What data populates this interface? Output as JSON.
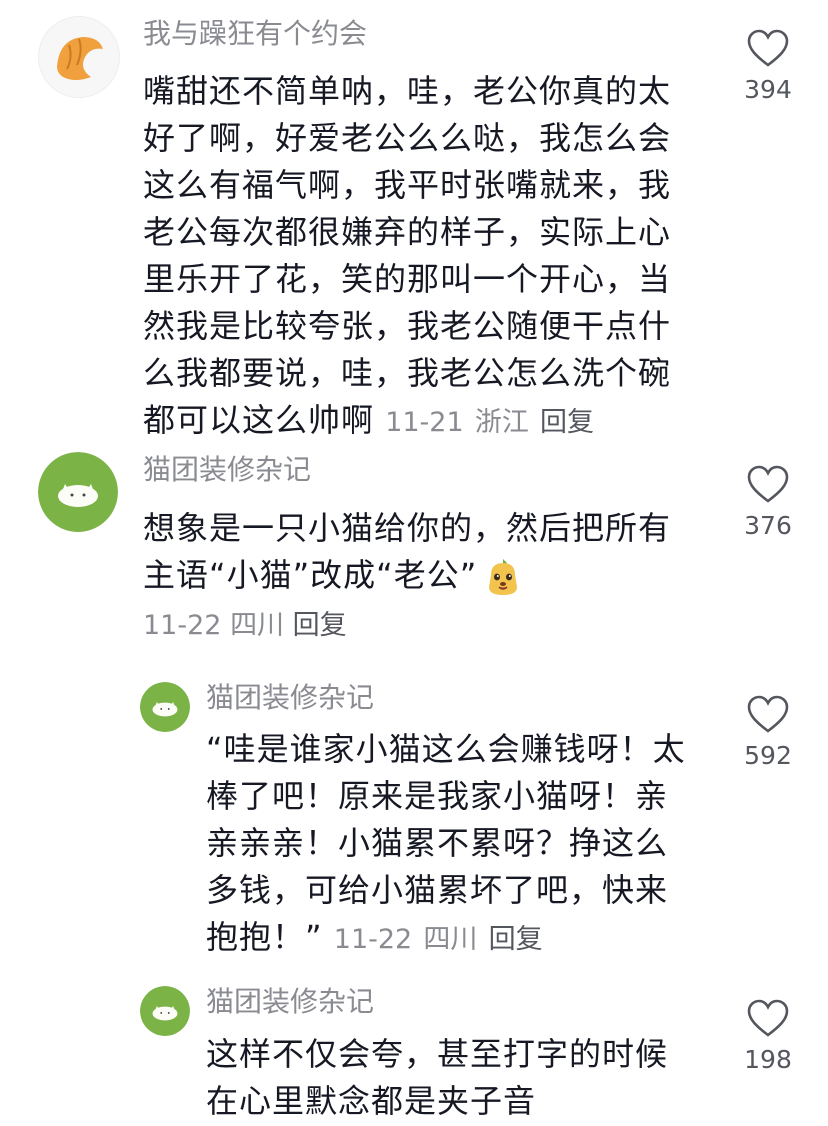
{
  "comments": [
    {
      "username": "我与躁狂有个约会",
      "text": "嘴甜还不简单呐，哇，老公你真的太好了啊，好爱老公么么哒，我怎么会这么有福气啊，我平时张嘴就来，我老公每次都很嫌弃的样子，实际上心里乐开了花，笑的那叫一个开心，当然我是比较夸张，我老公随便干点什么我都要说，哇，我老公怎么洗个碗都可以这么帅啊",
      "date": "11-21",
      "location": "浙江",
      "reply_label": "回复",
      "likes": "394",
      "avatar_icon": "croissant-icon"
    },
    {
      "username": "猫团装修杂记",
      "text": "想象是一只小猫给你的，然后把所有主语“小猫”改成“老公”",
      "emoji_icon": "dog-emoji-icon",
      "date": "11-22",
      "location": "四川",
      "reply_label": "回复",
      "likes": "376",
      "avatar_icon": "cat-avatar-icon"
    },
    {
      "username": "猫团装修杂记",
      "text": "“哇是谁家小猫这么会赚钱呀！太棒了吧！原来是我家小猫呀！亲亲亲亲！小猫累不累呀？挣这么多钱，可给小猫累坏了吧，快来抱抱！”",
      "date": "11-22",
      "location": "四川",
      "reply_label": "回复",
      "likes": "592",
      "avatar_icon": "cat-avatar-icon"
    },
    {
      "username": "猫团装修杂记",
      "text": "这样不仅会夸，甚至打字的时候在心里默念都是夹子音",
      "likes": "198",
      "avatar_icon": "cat-avatar-icon"
    }
  ],
  "colors": {
    "text": "#161823",
    "meta": "#8a8b91",
    "avatar_green": "#7cb347",
    "croissant": "#f0a03c"
  }
}
